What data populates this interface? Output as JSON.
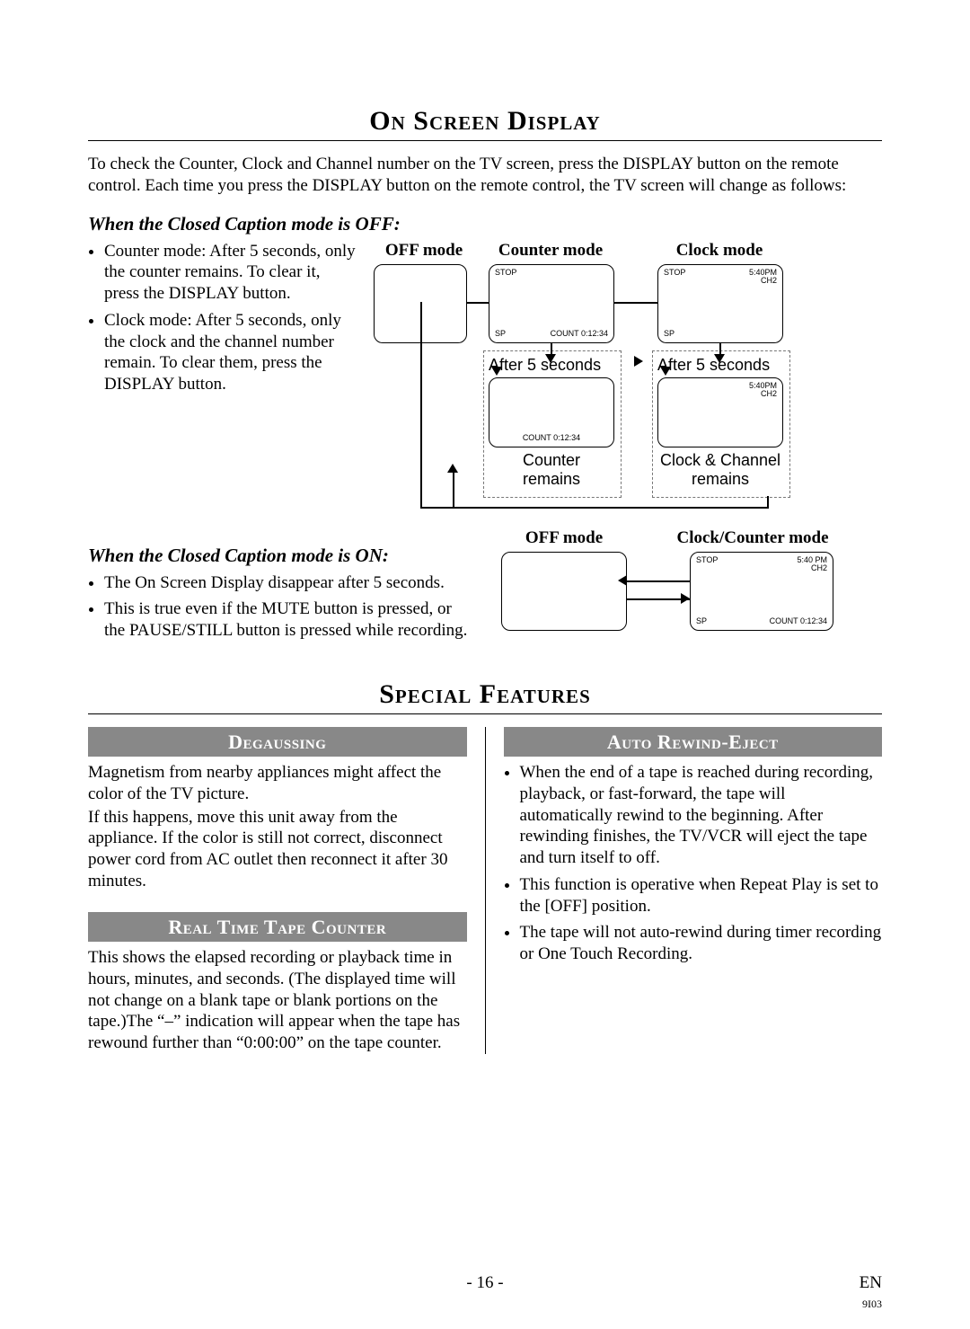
{
  "section1": {
    "title": "On Screen Display",
    "intro": "To check the Counter, Clock and Channel number on the TV screen, press the DISPLAY button on the remote control. Each time you press the DISPLAY button on the remote control, the TV screen will change as follows:",
    "cc_off": {
      "heading": "When the Closed Caption mode is OFF:",
      "bullets": [
        "Counter mode: After 5 seconds, only the counter remains. To clear it, press the DISPLAY button.",
        "Clock mode: After 5 seconds, only the clock and the channel number remain. To clear them, press the DISPLAY button."
      ],
      "labels": {
        "off_mode": "OFF mode",
        "counter_mode": "Counter mode",
        "clock_mode": "Clock mode",
        "after_5s": "After 5 seconds",
        "counter_remains": "Counter\nremains",
        "clock_channel_remains": "Clock & Channel\nremains"
      },
      "screens": {
        "counter_top": {
          "tl": "STOP",
          "bl": "SP",
          "bc_right": "COUNT 0:12:34"
        },
        "clock_top": {
          "tl": "STOP",
          "tr": "5:40PM\nCH2",
          "bl": "SP"
        },
        "counter_bottom": {
          "bc_right": "COUNT 0:12:34"
        },
        "clock_bottom": {
          "tr": "5:40PM\nCH2"
        }
      }
    },
    "cc_on": {
      "heading": "When the Closed Caption mode is ON:",
      "bullets": [
        "The On Screen Display disappear after 5 seconds.",
        "This is true even if the MUTE button is pressed, or the PAUSE/STILL button is pressed while recording."
      ],
      "labels": {
        "off_mode": "OFF mode",
        "clock_counter_mode": "Clock/Counter mode"
      },
      "screen": {
        "tl": "STOP",
        "tr": "5:40 PM\nCH2",
        "bl": "SP",
        "br_right": "COUNT  0:12:34"
      }
    }
  },
  "section2": {
    "title": "Special Features",
    "degaussing": {
      "title": "Degaussing",
      "p1": "Magnetism from nearby appliances might affect the color of the TV picture.",
      "p2": "If this happens, move this unit away from the appliance. If the color is still not correct, disconnect power cord from AC outlet then reconnect it after 30 minutes."
    },
    "tape_counter": {
      "title": "Real Time Tape Counter",
      "p": "This shows the elapsed recording or playback time in hours, minutes, and seconds. (The displayed time will not change on a blank tape or blank portions on the tape.)The “–” indication will appear when the tape has rewound further than “0:00:00” on the tape counter."
    },
    "auto_rewind": {
      "title": "Auto Rewind-Eject",
      "bullets": [
        "When the end of a tape is reached during recording, playback, or fast-forward, the tape will automatically rewind to the beginning. After rewinding finishes, the TV/VCR will eject the tape and turn itself to off.",
        "This function is operative when Repeat Play is set to the [OFF] position.",
        "The tape will not auto-rewind during timer recording or One Touch Recording."
      ]
    }
  },
  "footer": {
    "page": "- 16 -",
    "lang": "EN",
    "code": "9I03"
  }
}
